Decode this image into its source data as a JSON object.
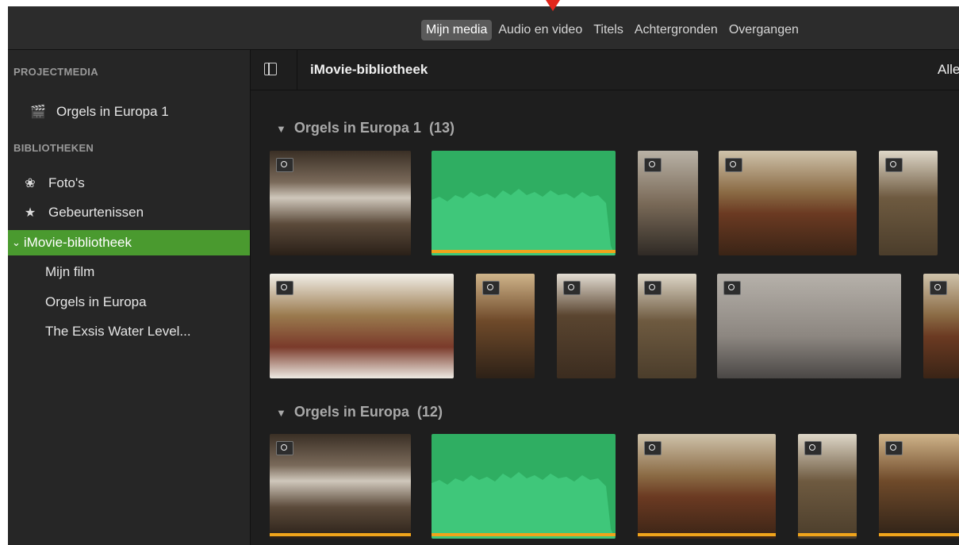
{
  "topbar": {
    "tabs": [
      {
        "label": "Mijn media",
        "active": true
      },
      {
        "label": "Audio en video",
        "active": false
      },
      {
        "label": "Titels",
        "active": false
      },
      {
        "label": "Achtergronden",
        "active": false
      },
      {
        "label": "Overgangen",
        "active": false
      }
    ]
  },
  "sidebar": {
    "project_header": "PROJECTMEDIA",
    "project_item": "Orgels in Europa 1",
    "libraries_header": "BIBLIOTHEKEN",
    "photos": "Foto's",
    "events": "Gebeurtenissen",
    "library": "iMovie-bibliotheek",
    "children": [
      "Mijn film",
      "Orgels in Europa",
      "The Exsis Water Level..."
    ]
  },
  "content": {
    "title": "iMovie-bibliotheek",
    "filter": "Alle",
    "groups": [
      {
        "name": "Orgels in Europa 1",
        "count": "(13)"
      },
      {
        "name": "Orgels in Europa",
        "count": "(12)"
      }
    ]
  },
  "colors": {
    "selection": "#4a9a2f",
    "audio": "#2fae62",
    "marker": "#e2261c",
    "range": "#f0a41b"
  }
}
